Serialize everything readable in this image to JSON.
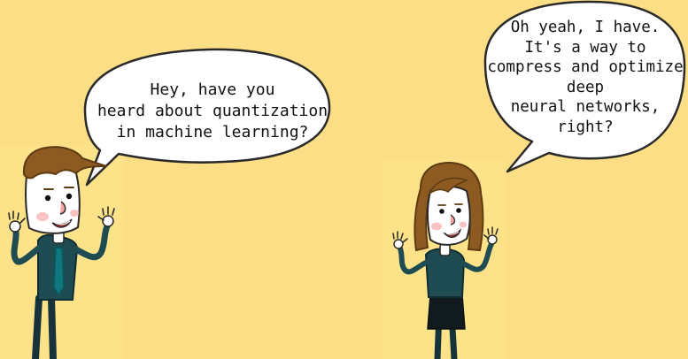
{
  "scene": {
    "background_color": "#fbde85",
    "panel_color": "#fbe088"
  },
  "dialogue": {
    "man": {
      "lines": [
        "Hey, have you",
        "heard about quantization",
        "in machine learning?"
      ]
    },
    "woman": {
      "lines": [
        "Oh yeah, I have.",
        "It's a way to",
        "compress and optimize",
        "deep",
        "neural networks,",
        "right?"
      ]
    }
  }
}
